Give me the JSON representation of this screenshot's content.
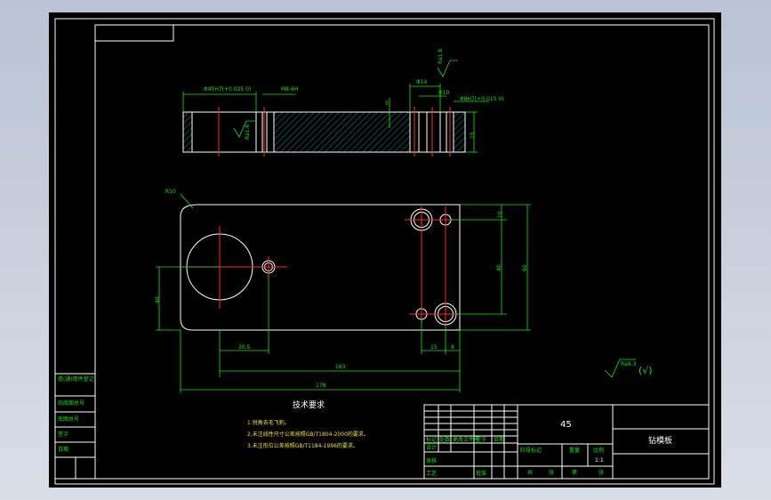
{
  "colors": {
    "line": "#ffffff",
    "dim": "#19e619",
    "center": "#ff2a2a",
    "hatch": "#20d0d0",
    "note": "#f2e23a"
  },
  "section_view": {
    "dim_left": "Φ45H7(+0.025 0)",
    "dim_mid": "M8-6H",
    "dim_phi14": "Φ14",
    "dim_phi10": "Φ10",
    "dim_right": "Φ8H7(+0.015 0)",
    "dim_5": "5",
    "dim_height": "15",
    "roughness_top": "Ra1.6",
    "roughness_mid": "Ra1.6"
  },
  "plan_view": {
    "radius": "R10",
    "dim_10": "10",
    "dim_40": "40",
    "dim_60": "60",
    "dim_48": "48",
    "dim_30_5": "30.5",
    "dim_15": "15",
    "dim_8": "8",
    "dim_163": "163",
    "dim_178": "178"
  },
  "surface_mark": {
    "value": "Ra6.3",
    "rest": "(√)"
  },
  "notes": {
    "title": "技术要求",
    "items": [
      "1.锐角去毛飞刺。",
      "2.未注线性尺寸公差按照GB/T1804-2000的要求。",
      "3.未注形位公差按照GB/T1184-1996的要求。"
    ]
  },
  "title_block": {
    "material": "45",
    "part_name": "钻模板",
    "scale": "1:1",
    "labels": [
      "标记",
      "处数",
      "更改文件号",
      "签字",
      "日期",
      "设计",
      "审核",
      "工艺",
      "批准"
    ],
    "stage_labels": [
      "阶段标记",
      "重量",
      "比例"
    ],
    "sheet_labels": [
      "共",
      "张",
      "第",
      "张"
    ]
  },
  "left_strip": {
    "labels": [
      "借(通)用件登记",
      "旧底图总号",
      "底图总号",
      "签字",
      "日期"
    ]
  }
}
